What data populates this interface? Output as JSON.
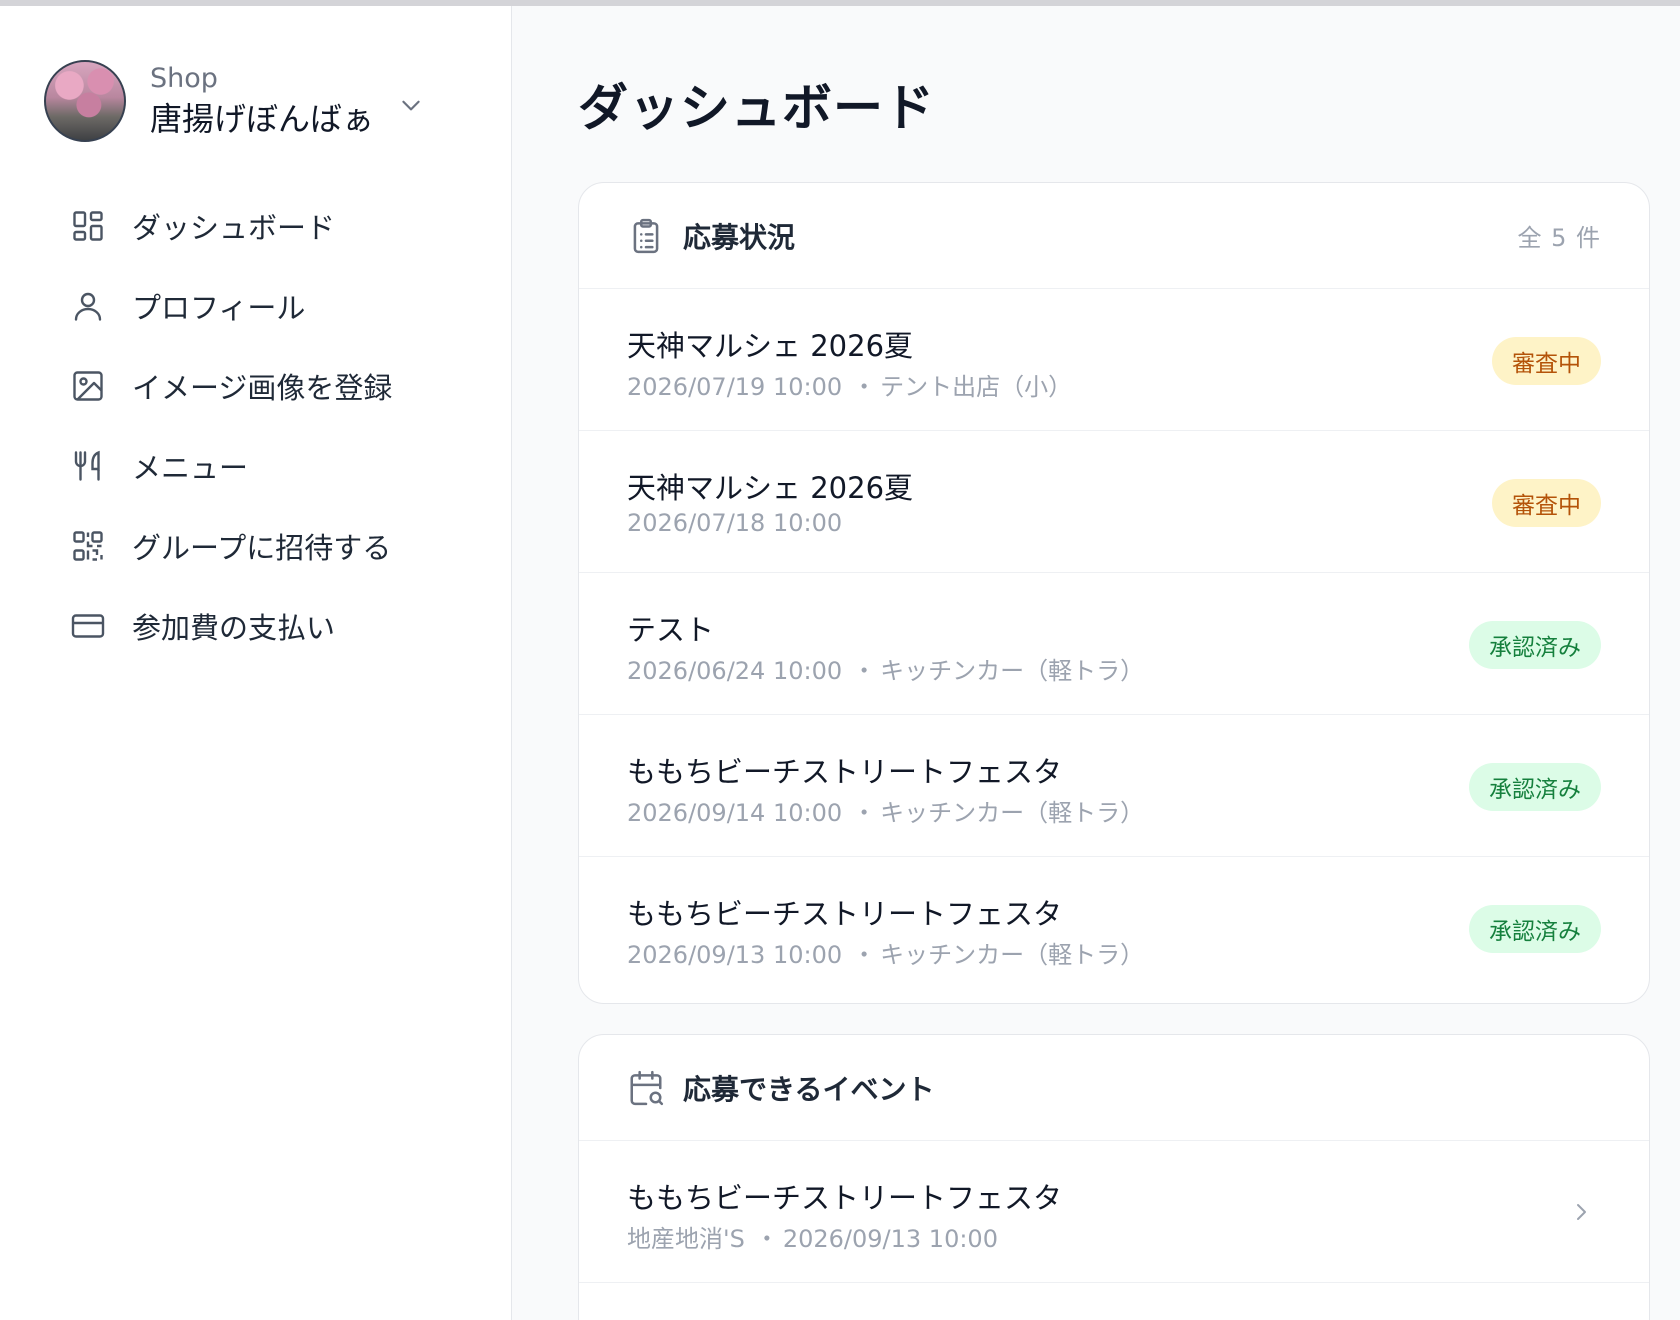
{
  "shop": {
    "label": "Shop",
    "name": "唐揚げぼんばぁ"
  },
  "nav": [
    {
      "label": "ダッシュボード",
      "icon": "dashboard-icon"
    },
    {
      "label": "プロフィール",
      "icon": "user-icon"
    },
    {
      "label": "イメージ画像を登録",
      "icon": "image-icon"
    },
    {
      "label": "メニュー",
      "icon": "utensils-icon"
    },
    {
      "label": "グループに招待する",
      "icon": "qr-code-icon"
    },
    {
      "label": "参加費の支払い",
      "icon": "credit-card-icon"
    }
  ],
  "page": {
    "title": "ダッシュボード"
  },
  "applications": {
    "title": "応募状況",
    "count": "全 5 件",
    "items": [
      {
        "title": "天神マルシェ 2026夏",
        "datetime": "2026/07/19 10:00",
        "sep": "・",
        "detail": "テント出店（小）",
        "status": "審査中"
      },
      {
        "title": "天神マルシェ 2026夏",
        "datetime": "2026/07/18 10:00",
        "sep": "",
        "detail": "",
        "status": "審査中"
      },
      {
        "title": "テスト",
        "datetime": "2026/06/24 10:00",
        "sep": "・",
        "detail": "キッチンカー（軽トラ）",
        "status": "承認済み"
      },
      {
        "title": "ももちビーチストリートフェスタ",
        "datetime": "2026/09/14 10:00",
        "sep": "・",
        "detail": "キッチンカー（軽トラ）",
        "status": "承認済み"
      },
      {
        "title": "ももちビーチストリートフェスタ",
        "datetime": "2026/09/13 10:00",
        "sep": "・",
        "detail": "キッチンカー（軽トラ）",
        "status": "承認済み"
      }
    ]
  },
  "events": {
    "title": "応募できるイベント",
    "items": [
      {
        "title": "ももちビーチストリートフェスタ",
        "organizer": "地産地消'S",
        "sep": "・",
        "datetime": "2026/09/13 10:00"
      }
    ]
  },
  "colors": {
    "review_bg": "#fef3c7",
    "review_text": "#b45309",
    "approved_bg": "#dcfce7",
    "approved_text": "#15803d"
  }
}
